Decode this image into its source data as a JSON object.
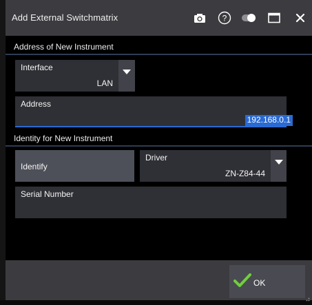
{
  "dialog": {
    "title": "Add External Switchmatrix",
    "icons": [
      "camera-icon",
      "help-icon",
      "toggle-icon",
      "maximize-icon",
      "close-icon"
    ]
  },
  "address_section": {
    "header": "Address of New Instrument",
    "interface": {
      "label": "Interface",
      "value": "LAN"
    },
    "address": {
      "label": "Address",
      "value": "192.168.0.1"
    }
  },
  "identity_section": {
    "header": "Identity for New Instrument",
    "identify_label": "Identify",
    "driver": {
      "label": "Driver",
      "value": "ZN-Z84-44"
    },
    "serial": {
      "label": "Serial Number",
      "value": ""
    }
  },
  "footer": {
    "ok_label": "OK"
  },
  "colors": {
    "accent": "#2a6ad3",
    "check": "#6fd13a",
    "titlebar": "#3c3c40",
    "field": "#2f3035"
  }
}
